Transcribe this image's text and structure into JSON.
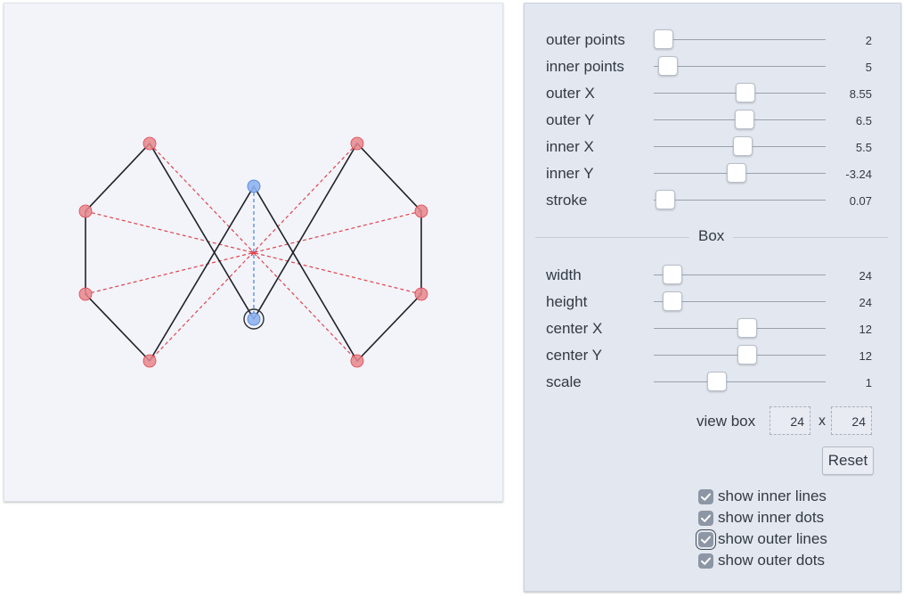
{
  "colors": {
    "canvas_bg": "#f2f4f9",
    "panel_bg": "#e3e7ef",
    "outer_dot": "#e8868c",
    "inner_dot": "#8fb3f0",
    "outer_line": "#e0434d",
    "inner_line": "#4a7fd9",
    "stroke": "#1e2229"
  },
  "sliders": [
    {
      "label": "outer points",
      "value": "2",
      "fraction": 0.0
    },
    {
      "label": "inner points",
      "value": "5",
      "fraction": 0.03
    },
    {
      "label": "outer X",
      "value": "8.55",
      "fraction": 0.54
    },
    {
      "label": "outer Y",
      "value": "6.5",
      "fraction": 0.53
    },
    {
      "label": "inner X",
      "value": "5.5",
      "fraction": 0.52
    },
    {
      "label": "inner Y",
      "value": "-3.24",
      "fraction": 0.48
    },
    {
      "label": "stroke",
      "value": "0.07",
      "fraction": 0.01
    }
  ],
  "box": {
    "title": "Box",
    "sliders": [
      {
        "label": "width",
        "value": "24",
        "fraction": 0.06
      },
      {
        "label": "height",
        "value": "24",
        "fraction": 0.06
      },
      {
        "label": "center X",
        "value": "12",
        "fraction": 0.55
      },
      {
        "label": "center Y",
        "value": "12",
        "fraction": 0.55
      },
      {
        "label": "scale",
        "value": "1",
        "fraction": 0.35
      }
    ],
    "viewbox_label": "view box",
    "viewbox_w": "24",
    "viewbox_sep": "x",
    "viewbox_h": "24",
    "reset_label": "Reset"
  },
  "checkboxes": [
    {
      "label": "show inner lines",
      "checked": true
    },
    {
      "label": "show inner dots",
      "checked": true
    },
    {
      "label": "show outer lines",
      "checked": true,
      "focused": true
    },
    {
      "label": "show outer dots",
      "checked": true
    }
  ]
}
